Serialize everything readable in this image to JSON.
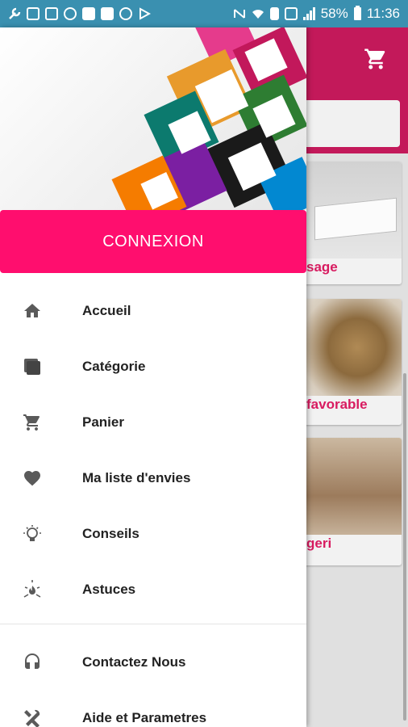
{
  "status_bar": {
    "battery": "58%",
    "time": "11:36"
  },
  "drawer": {
    "connexion_label": "CONNEXION",
    "items": [
      {
        "label": "Accueil",
        "icon": "home-icon"
      },
      {
        "label": "Catégorie",
        "icon": "category-icon"
      },
      {
        "label": "Panier",
        "icon": "cart-icon"
      },
      {
        "label": "Ma liste d'envies",
        "icon": "heart-icon"
      },
      {
        "label": "Conseils",
        "icon": "lightbulb-icon"
      },
      {
        "label": "Astuces",
        "icon": "tips-icon"
      }
    ],
    "secondary_items": [
      {
        "label": "Contactez Nous",
        "icon": "headset-icon"
      },
      {
        "label": "Aide et Parametres",
        "icon": "tools-icon"
      }
    ]
  },
  "background": {
    "card1_title": "sage",
    "card2_title": "favorable",
    "card3_title": "geri"
  },
  "colors": {
    "accent": "#ff0e6e",
    "toolbar": "#c3195a",
    "status_bar": "#3a90b0"
  }
}
